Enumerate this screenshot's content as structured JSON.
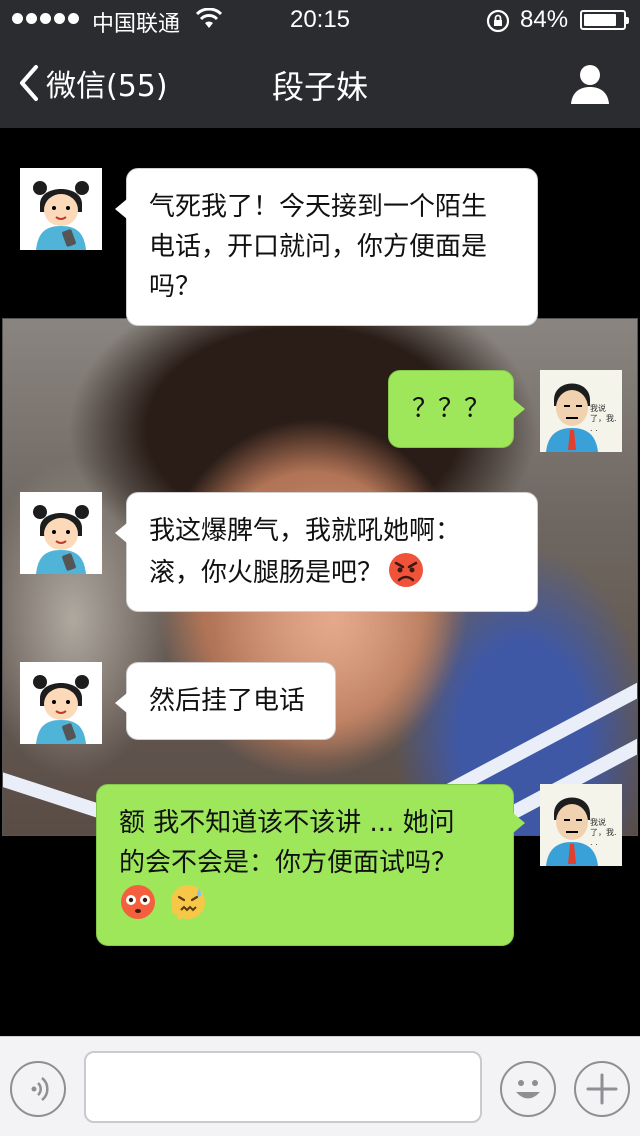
{
  "status_bar": {
    "carrier": "中国联通",
    "time": "20:15",
    "battery_percent": "84%",
    "battery_level": 0.84
  },
  "nav": {
    "back_label": "微信(55)",
    "title": "段子妹"
  },
  "messages": [
    {
      "side": "in",
      "sender": "段子妹",
      "text": "气死我了！今天接到一个陌生\n电话，开口就问，你方便面是\n吗？"
    },
    {
      "side": "out",
      "sender": "me",
      "text": "？？？"
    },
    {
      "side": "in",
      "sender": "段子妹",
      "text": "我这爆脾气，我就吼她啊：\n滚，你火腿肠是吧？",
      "emojis": [
        "angry-face"
      ]
    },
    {
      "side": "in",
      "sender": "段子妹",
      "text": "然后挂了电话"
    },
    {
      "side": "out",
      "sender": "me",
      "text": "额 我不知道该不该讲 ... 她问\n的会不会是：你方便面试吗？",
      "emojis": [
        "flushed-face",
        "anxious-sweat-face"
      ]
    }
  ],
  "my_avatar_caption": "我说了，我. . .",
  "input": {
    "placeholder": "",
    "value": ""
  },
  "colors": {
    "bar_bg": "#2b2c30",
    "incoming_bubble": "#ffffff",
    "outgoing_bubble": "#9ee65a",
    "chat_bg": "#000000",
    "input_bar_bg": "#f3f3f5"
  },
  "icons": [
    "back-chevron-icon",
    "profile-icon",
    "voice-icon",
    "emoji-icon",
    "plus-icon",
    "wifi-icon",
    "rotation-lock-icon",
    "battery-icon"
  ]
}
